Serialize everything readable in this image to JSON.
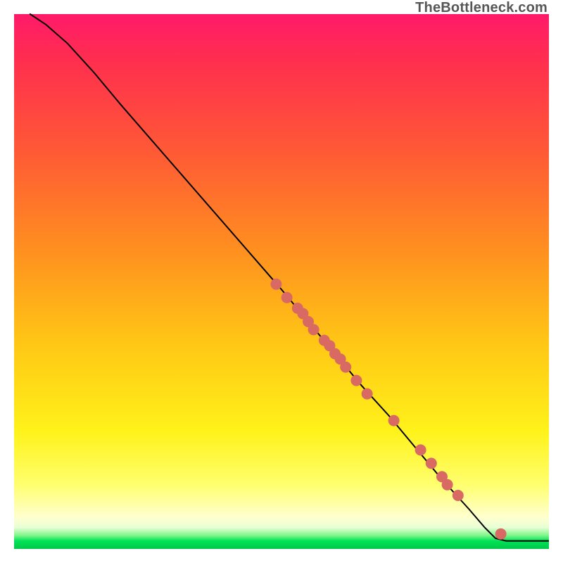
{
  "watermark": "TheBottleneck.com",
  "colors": {
    "curve": "#000000",
    "point": "#d86a63",
    "gradient_top": "#ff1a69",
    "gradient_bottom": "#00c84b"
  },
  "chart_data": {
    "type": "line",
    "title": "",
    "xlabel": "",
    "ylabel": "",
    "xlim": [
      0,
      100
    ],
    "ylim": [
      0,
      100
    ],
    "grid": false,
    "legend": false,
    "series": [
      {
        "name": "curve",
        "type": "line",
        "x": [
          3,
          6,
          10,
          15,
          20,
          30,
          40,
          50,
          55,
          60,
          65,
          70,
          75,
          80,
          85,
          88,
          90,
          92
        ],
        "y": [
          100,
          98,
          94.5,
          89,
          83,
          71.5,
          60,
          48.5,
          42.5,
          36.5,
          30.5,
          25,
          19,
          13,
          7.5,
          4,
          2,
          1.5
        ]
      },
      {
        "name": "flat-tail",
        "type": "line",
        "x": [
          92,
          100
        ],
        "y": [
          1.5,
          1.5
        ]
      },
      {
        "name": "highlighted-points",
        "type": "scatter",
        "x": [
          49,
          51,
          53,
          54,
          55,
          56,
          58,
          59,
          60,
          61,
          62,
          64,
          66,
          71,
          76,
          78,
          80,
          81,
          83,
          91
        ],
        "y": [
          49.5,
          47,
          45,
          44,
          42.5,
          41,
          39,
          38,
          36.5,
          35.5,
          34,
          31.5,
          29,
          24,
          18.5,
          16,
          13.5,
          12,
          10,
          2.8
        ]
      }
    ]
  }
}
